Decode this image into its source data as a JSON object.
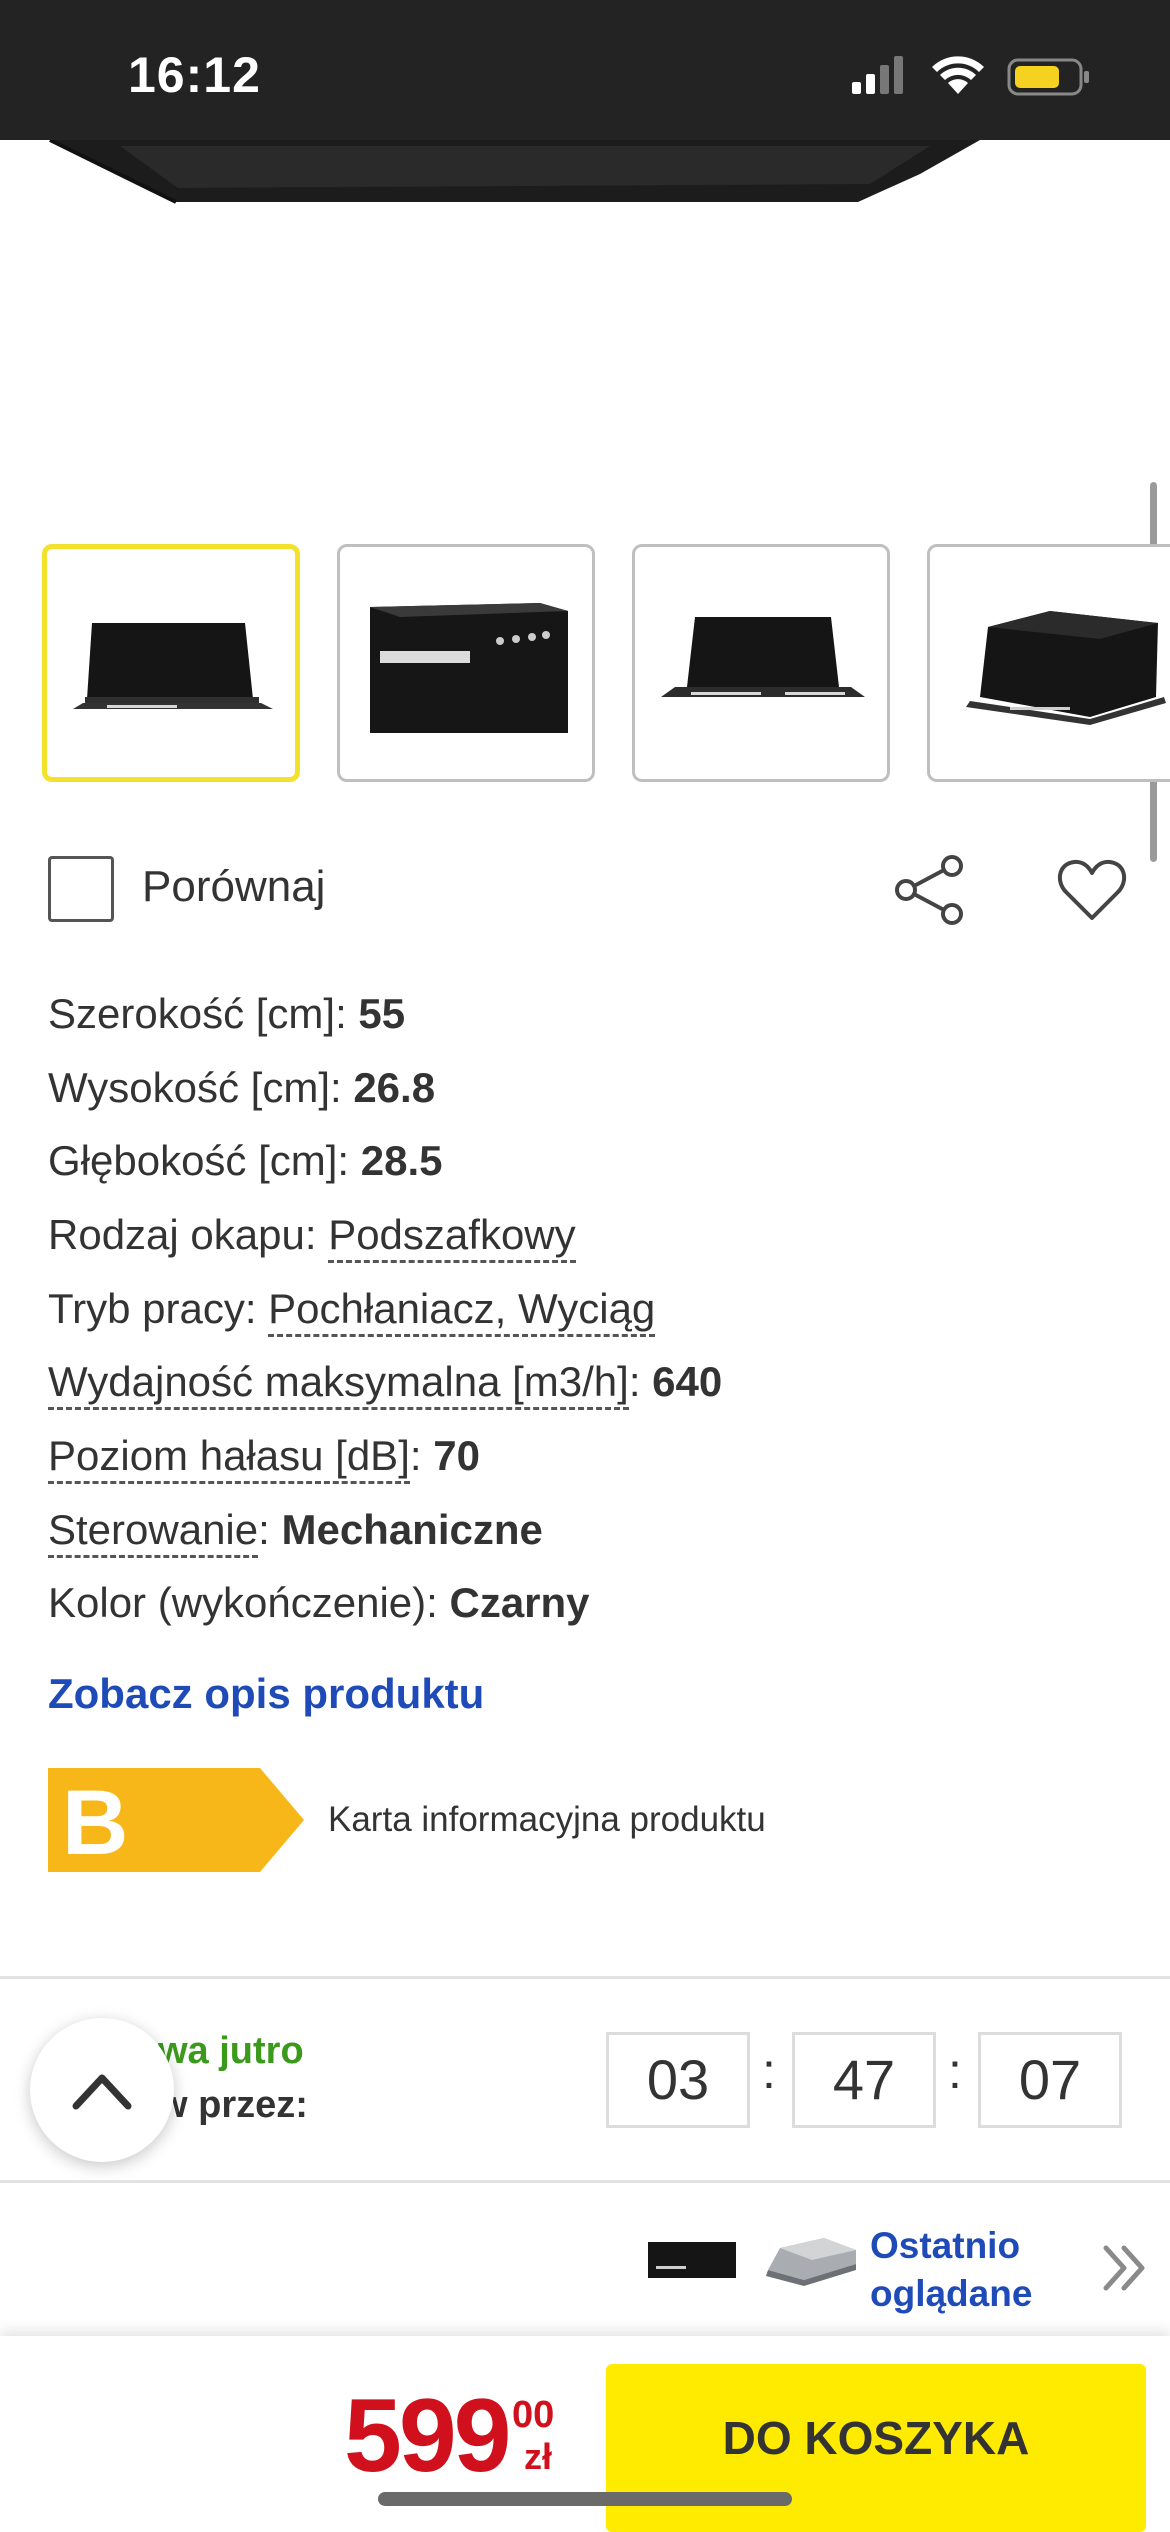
{
  "status_bar": {
    "time": "16:12"
  },
  "gallery": {
    "thumbnails": [
      {
        "name": "thumbnail-front",
        "selected": true
      },
      {
        "name": "thumbnail-closeup",
        "selected": false
      },
      {
        "name": "thumbnail-front-2",
        "selected": false
      },
      {
        "name": "thumbnail-angle",
        "selected": false
      }
    ]
  },
  "actions": {
    "compare_label": "Porównaj",
    "share_icon": "share-icon",
    "favorite_icon": "heart-icon"
  },
  "specs": [
    {
      "label": "Szerokość [cm]: ",
      "value": "55",
      "link": false
    },
    {
      "label": "Wysokość [cm]: ",
      "value": "26.8",
      "link": false
    },
    {
      "label": "Głębokość [cm]: ",
      "value": "28.5",
      "link": false
    },
    {
      "label": "Rodzaj okapu: ",
      "value": "Podszafkowy",
      "link": true
    },
    {
      "label": "Tryb pracy: ",
      "value": "Pochłaniacz, Wyciąg",
      "link": true
    },
    {
      "label": "Wydajność maksymalna [m3/h]",
      "value": "640",
      "link": false
    },
    {
      "label": "Poziom hałasu [dB]",
      "value": "70",
      "link": false
    },
    {
      "label": "Sterowanie",
      "value": "Mechaniczne",
      "link": false
    },
    {
      "label": "Kolor (wykończenie): ",
      "value": "Czarny",
      "link": false
    }
  ],
  "description_link": "Zobacz opis produktu",
  "energy": {
    "class": "B",
    "color": "#f7b718",
    "info_label": "Karta informacyjna produktu"
  },
  "delivery": {
    "line1": "wa jutro",
    "line2": "w przez:",
    "hours": "03",
    "minutes": "47",
    "seconds": "07",
    "separator": ":"
  },
  "recently_viewed": {
    "label_line1": "Ostatnio",
    "label_line2": "oglądane"
  },
  "cart": {
    "price_main": "599",
    "price_cents": "00",
    "currency": "zł",
    "button_label": "DO KOSZYKA",
    "price_color": "#d0111d",
    "button_color": "#ffeb00"
  }
}
